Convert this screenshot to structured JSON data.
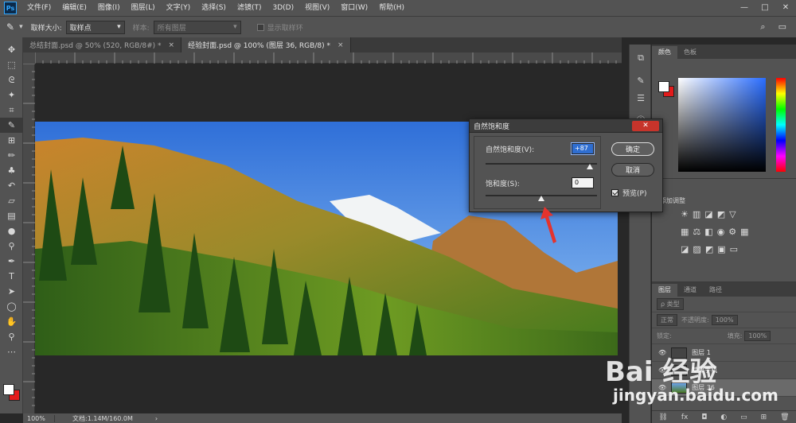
{
  "app": {
    "logo": "Ps"
  },
  "menu": [
    "文件(F)",
    "编辑(E)",
    "图像(I)",
    "图层(L)",
    "文字(Y)",
    "选择(S)",
    "滤镜(T)",
    "3D(D)",
    "视图(V)",
    "窗口(W)",
    "帮助(H)"
  ],
  "window_controls": {
    "minimize": "—",
    "restore": "□",
    "close": "✕"
  },
  "options": {
    "sample_size_label": "取样大小:",
    "sample_size_value": "取样点",
    "sample_label": "样本:",
    "sample_value": "所有图层",
    "show_ring_label": "显示取样环"
  },
  "tabs": [
    {
      "title": "总结封面.psd @ 50% (520, RGB/8#) *",
      "close": "×"
    },
    {
      "title": "经验封面.psd @ 100% (图层 36, RGB/8) *",
      "close": "×"
    }
  ],
  "status": {
    "zoom": "100%",
    "doc_info": "文档:1.14M/160.0M",
    "arrow": "›"
  },
  "color_panel": {
    "tabs": [
      "颜色",
      "色板"
    ]
  },
  "adjust_panel": {
    "title": "添加调整"
  },
  "layers_panel": {
    "tabs": [
      "图层",
      "通道",
      "路径"
    ],
    "filter_label": "ρ 类型",
    "blend_mode": "正常",
    "opacity_label": "不透明度:",
    "opacity_value": "100%",
    "lock_label": "锁定:",
    "fill_label": "填充:",
    "fill_value": "100%",
    "layers": [
      {
        "name": "图层 1"
      },
      {
        "name": "苹果手机"
      },
      {
        "name": "图层 36"
      }
    ]
  },
  "dialog": {
    "title": "自然饱和度",
    "close": "✕",
    "vibrance_label": "自然饱和度(V):",
    "vibrance_value": "+87",
    "vibrance_fraction": 0.935,
    "saturation_label": "饱和度(S):",
    "saturation_value": "0",
    "saturation_fraction": 0.5,
    "ok": "确定",
    "cancel": "取消",
    "preview": "预览(P)"
  },
  "watermark": {
    "brand": "Bai  经验",
    "url": "jingyan.baidu.com"
  }
}
